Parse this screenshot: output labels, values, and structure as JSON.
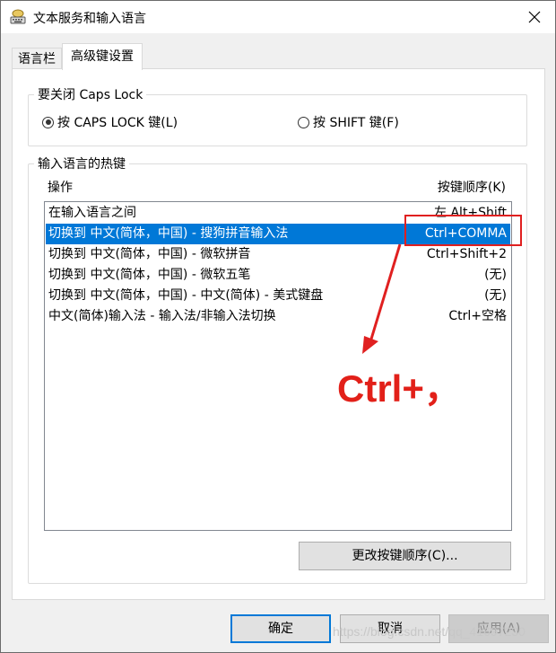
{
  "window": {
    "title": "文本服务和输入语言"
  },
  "tabs": [
    {
      "label": "语言栏"
    },
    {
      "label": "高级键设置"
    }
  ],
  "caps_group": {
    "label": "要关闭 Caps Lock",
    "options": [
      {
        "label": "按 CAPS LOCK 键(L)",
        "checked": true
      },
      {
        "label": "按 SHIFT 键(F)",
        "checked": false
      }
    ]
  },
  "hotkey_group": {
    "label": "输入语言的热键",
    "col_action": "操作",
    "col_key": "按键顺序(K)",
    "rows": [
      {
        "action": "在输入语言之间",
        "key": "左 Alt+Shift"
      },
      {
        "action": "切换到 中文(简体，中国) - 搜狗拼音输入法",
        "key": "Ctrl+COMMA",
        "selected": true
      },
      {
        "action": "切换到 中文(简体，中国) - 微软拼音",
        "key": "Ctrl+Shift+2"
      },
      {
        "action": "切换到 中文(简体，中国) - 微软五笔",
        "key": "(无)"
      },
      {
        "action": "切换到 中文(简体，中国) - 中文(简体) - 美式键盘",
        "key": "(无)"
      },
      {
        "action": "中文(简体)输入法 - 输入法/非输入法切换",
        "key": "Ctrl+空格"
      }
    ],
    "change_button": "更改按键顺序(C)..."
  },
  "buttons": {
    "ok": "确定",
    "cancel": "取消",
    "apply": "应用(A)"
  },
  "annotation": {
    "text": "Ctrl+，",
    "color": "#e22019"
  },
  "watermark": "https://blog.csdn.net/qq_41697230",
  "colors": {
    "selection": "#0078d7",
    "highlight": "#e02020"
  }
}
